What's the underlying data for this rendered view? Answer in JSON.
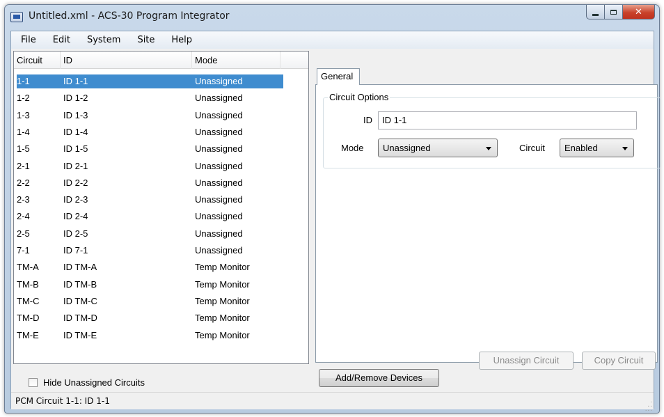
{
  "window": {
    "title": "Untitled.xml - ACS-30 Program Integrator"
  },
  "menu": [
    "File",
    "Edit",
    "System",
    "Site",
    "Help"
  ],
  "list": {
    "columns": {
      "circuit": "Circuit",
      "id": "ID",
      "mode": "Mode"
    },
    "rows": [
      {
        "circuit": "1-1",
        "id": "ID 1-1",
        "mode": "Unassigned"
      },
      {
        "circuit": "1-2",
        "id": "ID 1-2",
        "mode": "Unassigned"
      },
      {
        "circuit": "1-3",
        "id": "ID 1-3",
        "mode": "Unassigned"
      },
      {
        "circuit": "1-4",
        "id": "ID 1-4",
        "mode": "Unassigned"
      },
      {
        "circuit": "1-5",
        "id": "ID 1-5",
        "mode": "Unassigned"
      },
      {
        "circuit": "2-1",
        "id": "ID 2-1",
        "mode": "Unassigned"
      },
      {
        "circuit": "2-2",
        "id": "ID 2-2",
        "mode": "Unassigned"
      },
      {
        "circuit": "2-3",
        "id": "ID 2-3",
        "mode": "Unassigned"
      },
      {
        "circuit": "2-4",
        "id": "ID 2-4",
        "mode": "Unassigned"
      },
      {
        "circuit": "2-5",
        "id": "ID 2-5",
        "mode": "Unassigned"
      },
      {
        "circuit": "7-1",
        "id": "ID 7-1",
        "mode": "Unassigned"
      },
      {
        "circuit": "TM-A",
        "id": "ID TM-A",
        "mode": "Temp Monitor"
      },
      {
        "circuit": "TM-B",
        "id": "ID TM-B",
        "mode": "Temp Monitor"
      },
      {
        "circuit": "TM-C",
        "id": "ID TM-C",
        "mode": "Temp Monitor"
      },
      {
        "circuit": "TM-D",
        "id": "ID TM-D",
        "mode": "Temp Monitor"
      },
      {
        "circuit": "TM-E",
        "id": "ID TM-E",
        "mode": "Temp Monitor"
      }
    ],
    "selected_circuit": "1-1",
    "hide_unassigned_label": "Hide Unassigned Circuits",
    "hide_unassigned_checked": false
  },
  "tabs": {
    "general": "General"
  },
  "circuit_options": {
    "group_label": "Circuit Options",
    "id_label": "ID",
    "id_value": "ID 1-1",
    "mode_label": "Mode",
    "mode_value": "Unassigned",
    "circuit_label": "Circuit",
    "circuit_value": "Enabled"
  },
  "buttons": {
    "unassign": "Unassign Circuit",
    "copy": "Copy Circuit",
    "add_remove": "Add/Remove Devices"
  },
  "status": {
    "text": "PCM Circuit 1-1: ID 1-1"
  },
  "colors": {
    "selection": "#3f8ccf",
    "close_button": "#c9432b"
  }
}
